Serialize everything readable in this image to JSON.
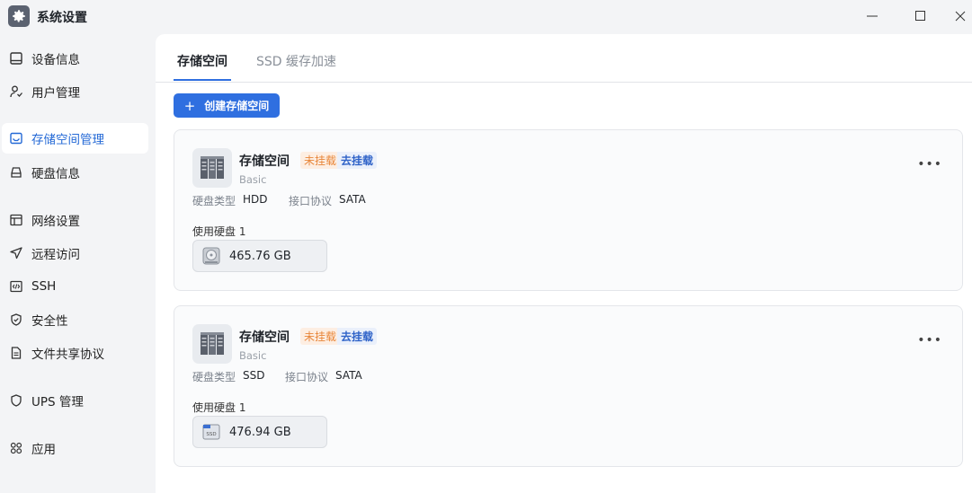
{
  "window": {
    "title": "系统设置",
    "app_icon": "gear-icon",
    "controls": [
      "minimize-icon",
      "maximize-icon",
      "close-icon"
    ]
  },
  "sidebar": {
    "items": [
      {
        "label": "设备信息",
        "icon": "monitor-icon",
        "active": false
      },
      {
        "label": "用户管理",
        "icon": "user-icon",
        "active": false
      },
      {
        "label": "存储空间管理",
        "icon": "storage-icon",
        "active": true
      },
      {
        "label": "硬盘信息",
        "icon": "harddisk-icon",
        "active": false
      },
      {
        "label": "网络设置",
        "icon": "network-icon",
        "active": false
      },
      {
        "label": "远程访问",
        "icon": "send-icon",
        "active": false
      },
      {
        "label": "SSH",
        "icon": "code-icon",
        "active": false
      },
      {
        "label": "安全性",
        "icon": "shield-icon",
        "active": false
      },
      {
        "label": "文件共享协议",
        "icon": "document-icon",
        "active": false
      },
      {
        "label": "UPS 管理",
        "icon": "ups-icon",
        "active": false
      },
      {
        "label": "应用",
        "icon": "apps-icon",
        "active": false
      }
    ]
  },
  "tabs": [
    {
      "label": "存储空间",
      "active": true
    },
    {
      "label": "SSD 缓存加速",
      "active": false
    }
  ],
  "toolbar": {
    "create_label": "创建存储空间"
  },
  "cards": [
    {
      "name": "存储空间",
      "status": "未挂载",
      "action": "去挂载",
      "type": "Basic",
      "disk_type_label": "硬盘类型",
      "disk_type": "HDD",
      "interface_label": "接口协议",
      "interface": "SATA",
      "disk_used_label": "使用硬盘 1",
      "disk_size": "465.76 GB",
      "disk_icon": "hdd-drive-icon"
    },
    {
      "name": "存储空间",
      "status": "未挂载",
      "action": "去挂载",
      "type": "Basic",
      "disk_type_label": "硬盘类型",
      "disk_type": "SSD",
      "interface_label": "接口协议",
      "interface": "SATA",
      "disk_used_label": "使用硬盘 1",
      "disk_size": "476.94 GB",
      "disk_icon": "ssd-drive-icon",
      "disk_icon_text": "SSD"
    }
  ],
  "colors": {
    "accent": "#2f6fe0",
    "unmounted_text": "#e8863a",
    "unmounted_bg": "#fdeee2",
    "mount_link": "#2f63c8"
  }
}
